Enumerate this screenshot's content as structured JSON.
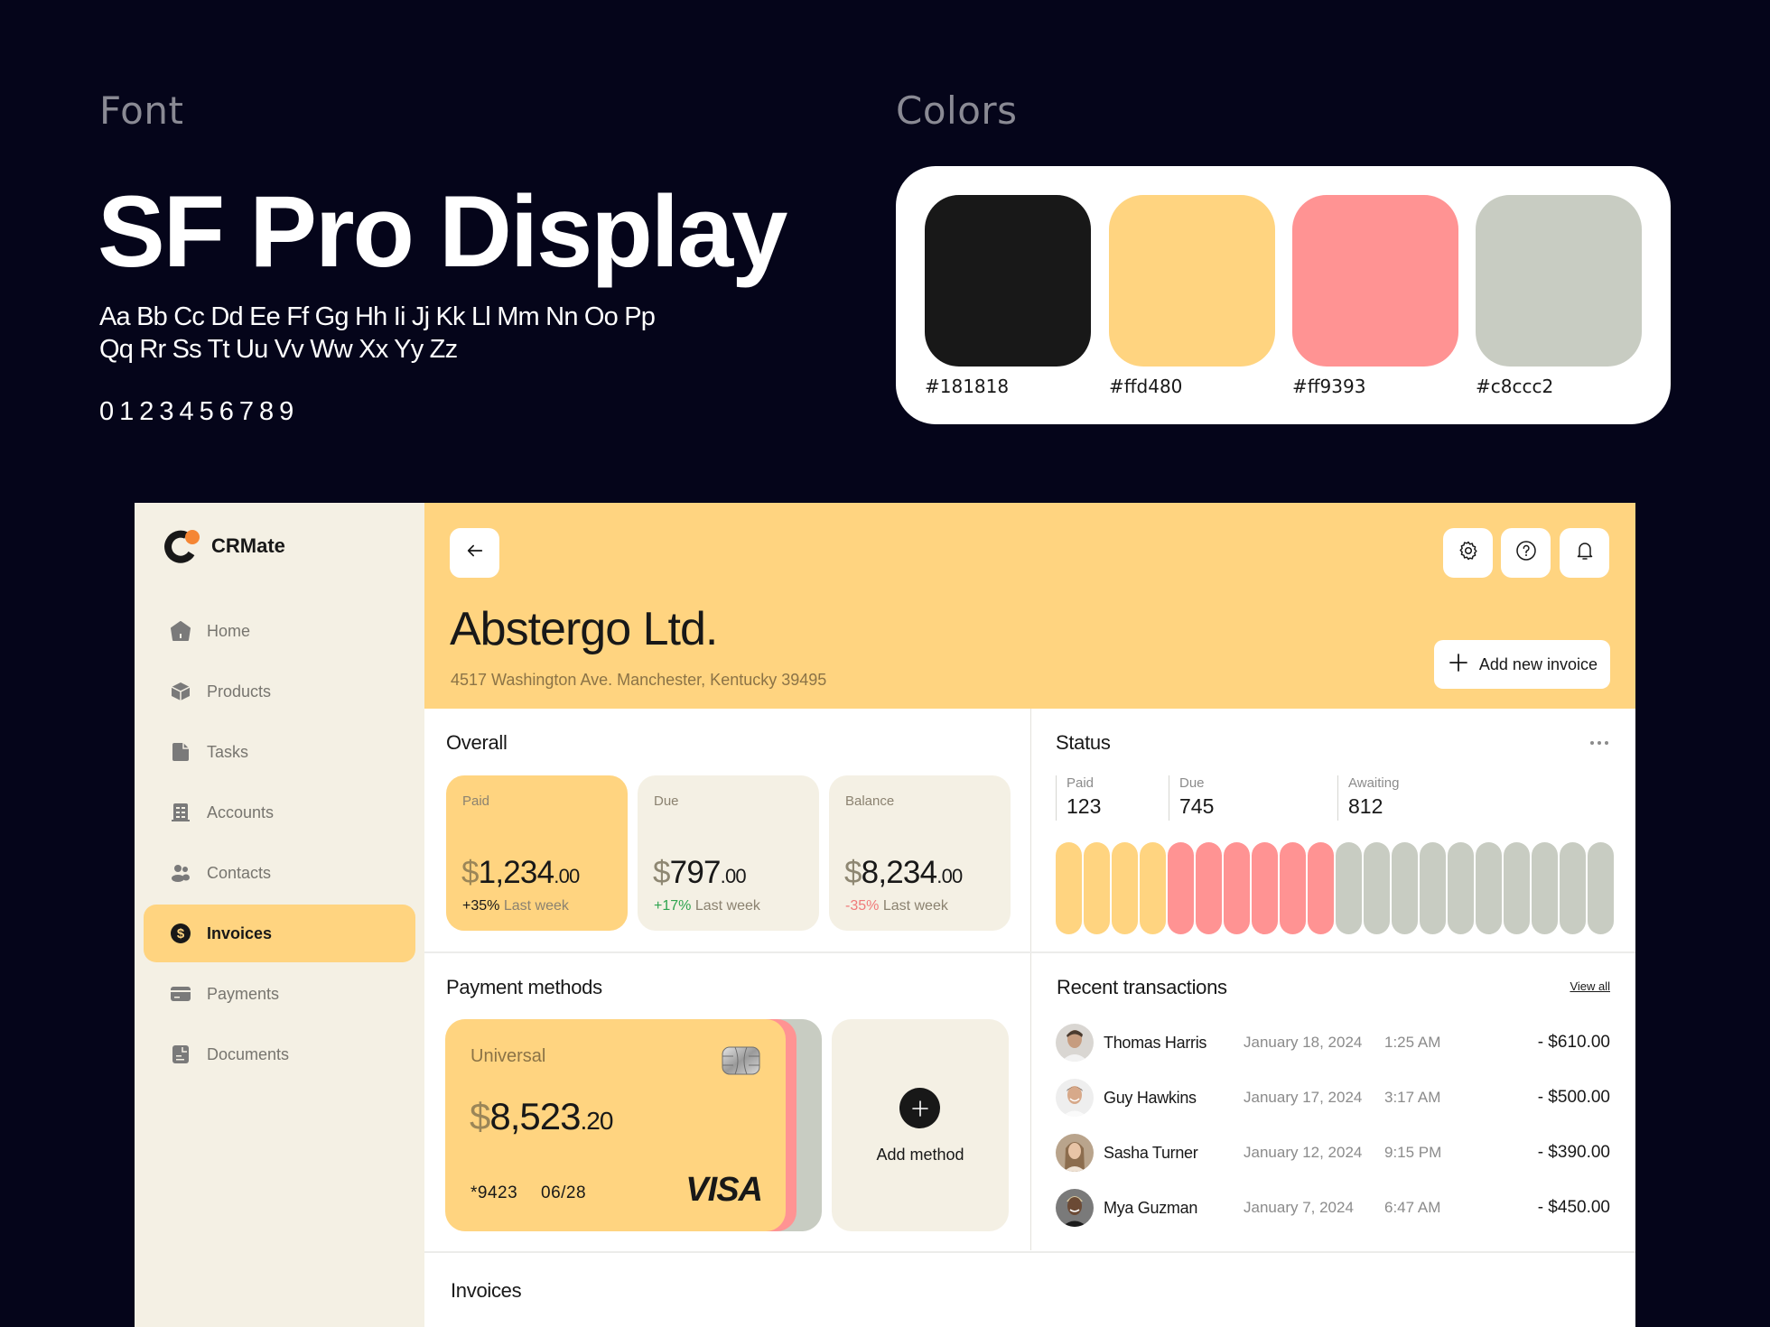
{
  "showcase": {
    "font_label": "Font",
    "font_name": "SF Pro Display",
    "alphabet": "Aa Bb Cc Dd Ee Ff Gg Hh Ii Jj Kk Ll Mm Nn Oo Pp Qq Rr Ss Tt Uu Vv Ww Xx Yy Zz",
    "digits": "0123456789",
    "colors_label": "Colors",
    "colors": [
      {
        "hex": "#181818",
        "label": "#181818"
      },
      {
        "hex": "#ffd480",
        "label": "#ffd480"
      },
      {
        "hex": "#ff9393",
        "label": "#ff9393"
      },
      {
        "hex": "#c8ccc2",
        "label": "#c8ccc2"
      }
    ]
  },
  "app": {
    "name": "CRMate",
    "accent": "#ffd480",
    "logo_dot_color": "#f58634"
  },
  "sidebar": {
    "items": [
      {
        "label": "Home",
        "icon": "home-icon",
        "active": false
      },
      {
        "label": "Products",
        "icon": "box-icon",
        "active": false
      },
      {
        "label": "Tasks",
        "icon": "file-icon",
        "active": false
      },
      {
        "label": "Accounts",
        "icon": "building-icon",
        "active": false
      },
      {
        "label": "Contacts",
        "icon": "users-icon",
        "active": false
      },
      {
        "label": "Invoices",
        "icon": "dollar-icon",
        "active": true
      },
      {
        "label": "Payments",
        "icon": "credit-card-icon",
        "active": false
      },
      {
        "label": "Documents",
        "icon": "document-icon",
        "active": false
      }
    ]
  },
  "header": {
    "back_icon": "arrow-left-icon",
    "company": "Abstergo Ltd.",
    "address": "4517 Washington Ave. Manchester, Kentucky 39495",
    "actions": [
      "gear-icon",
      "help-icon",
      "bell-icon"
    ],
    "add_invoice_label": "Add new invoice"
  },
  "overall": {
    "title": "Overall",
    "cards": [
      {
        "label": "Paid",
        "currency": "$",
        "whole": "1,234",
        "cents": ".00",
        "change": "+35%",
        "change_color": "#181818",
        "period": "Last week"
      },
      {
        "label": "Due",
        "currency": "$",
        "whole": "797",
        "cents": ".00",
        "change": "+17%",
        "change_color": "#2ea44f",
        "period": "Last week"
      },
      {
        "label": "Balance",
        "currency": "$",
        "whole": "8,234",
        "cents": ".00",
        "change": "-35%",
        "change_color": "#f07a7a",
        "period": "Last week"
      }
    ]
  },
  "status": {
    "title": "Status",
    "menu_icon": "more-horizontal-icon",
    "groups": [
      {
        "label": "Paid",
        "value": "123",
        "pills": 4,
        "color": "#ffd480"
      },
      {
        "label": "Due",
        "value": "745",
        "pills": 6,
        "color": "#ff9393"
      },
      {
        "label": "Awaiting",
        "value": "812",
        "pills": 10,
        "color": "#c8ccc2"
      }
    ]
  },
  "payment_methods": {
    "title": "Payment methods",
    "card": {
      "name": "Universal",
      "currency": "$",
      "whole": "8,523",
      "cents": ".20",
      "number": "*9423",
      "expiry": "06/28",
      "brand": "VISA"
    },
    "add_label": "Add method"
  },
  "transactions": {
    "title": "Recent transactions",
    "view_all": "View all",
    "rows": [
      {
        "name": "Thomas Harris",
        "date": "January 18, 2024",
        "time": "1:25 AM",
        "amount": "- $610.00"
      },
      {
        "name": "Guy Hawkins",
        "date": "January 17, 2024",
        "time": "3:17 AM",
        "amount": "- $500.00"
      },
      {
        "name": "Sasha Turner",
        "date": "January 12, 2024",
        "time": "9:15 PM",
        "amount": "- $390.00"
      },
      {
        "name": "Mya Guzman",
        "date": "January 7, 2024",
        "time": "6:47 AM",
        "amount": "- $450.00"
      }
    ]
  },
  "invoices": {
    "title": "Invoices"
  }
}
